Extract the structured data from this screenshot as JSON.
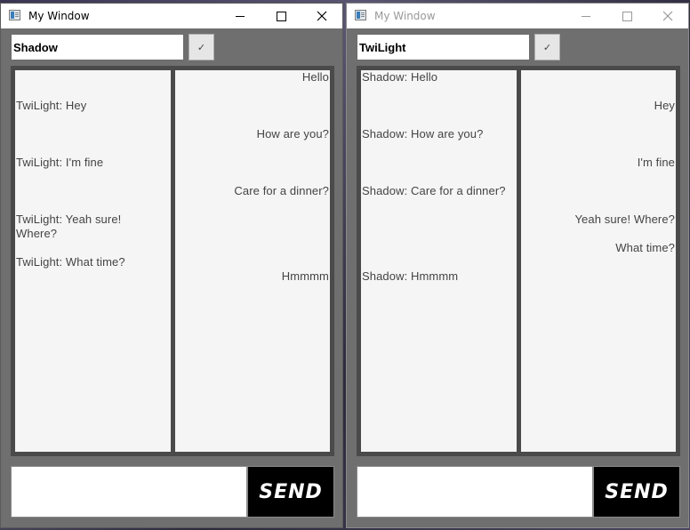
{
  "windows": [
    {
      "title": "My Window",
      "name_value": "Shadow",
      "check_label": "✓",
      "send_label": "SEND",
      "left_messages": [
        "TwiLight: Hey",
        "TwiLight: I'm fine",
        "TwiLight: Yeah sure! Where?",
        "TwiLight: What time?"
      ],
      "right_messages": [
        "Hello",
        "How are you?",
        "Care for a dinner?",
        "Hmmmm"
      ]
    },
    {
      "title": "My Window",
      "name_value": "TwiLight",
      "check_label": "✓",
      "send_label": "SEND",
      "left_messages": [
        "Shadow: Hello",
        "Shadow: How are you?",
        "Shadow: Care for a dinner?",
        "Shadow: Hmmmm"
      ],
      "right_messages": [
        "Hey",
        "I'm fine",
        "Yeah sure! Where?",
        "What time?"
      ]
    }
  ]
}
